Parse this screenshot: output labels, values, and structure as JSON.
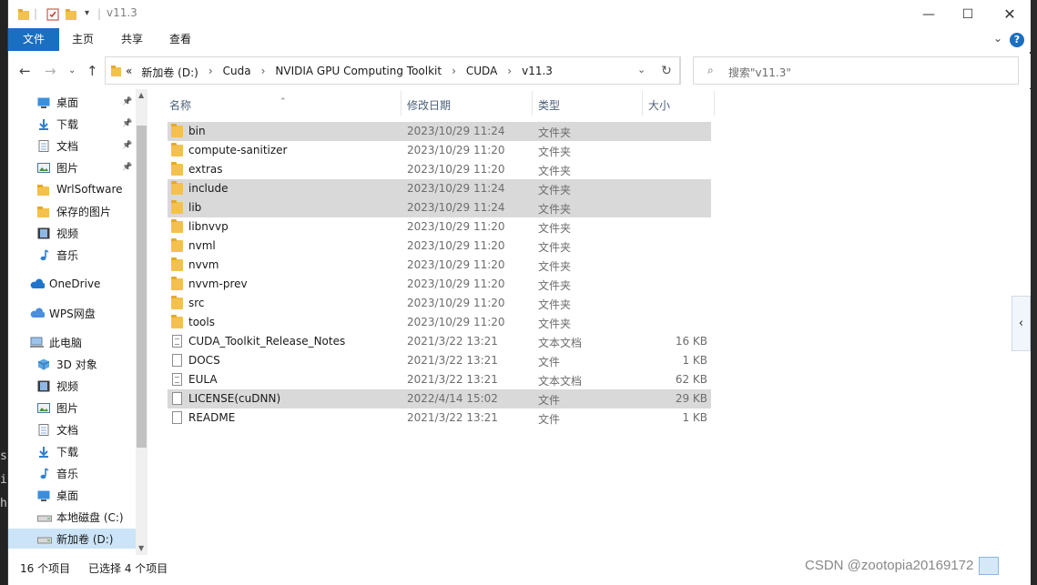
{
  "window": {
    "title": "v11.3"
  },
  "ribbon": {
    "tabs": [
      "文件",
      "主页",
      "共享",
      "查看"
    ]
  },
  "address": {
    "chevron": "«",
    "crumbs": [
      "新加卷 (D:)",
      "Cuda",
      "NVIDIA GPU Computing Toolkit",
      "CUDA",
      "v11.3"
    ],
    "separator": "›"
  },
  "search": {
    "placeholder": "搜索\"v11.3\""
  },
  "sidebar": {
    "items": [
      {
        "label": "桌面",
        "icon": "desktop-icon",
        "pinned": true
      },
      {
        "label": "下载",
        "icon": "download-icon",
        "pinned": true
      },
      {
        "label": "文档",
        "icon": "documents-icon",
        "pinned": true
      },
      {
        "label": "图片",
        "icon": "pictures-icon",
        "pinned": true
      },
      {
        "label": "WrlSoftware",
        "icon": "folder-icon",
        "pinned": false
      },
      {
        "label": "保存的图片",
        "icon": "folder-icon",
        "pinned": false
      },
      {
        "label": "视频",
        "icon": "videos-icon",
        "pinned": false
      },
      {
        "label": "音乐",
        "icon": "music-icon",
        "pinned": false
      },
      {
        "label": "OneDrive",
        "icon": "onedrive-icon",
        "pinned": false
      },
      {
        "label": "WPS网盘",
        "icon": "cloud-icon",
        "pinned": false
      },
      {
        "label": "此电脑",
        "icon": "computer-icon",
        "pinned": false
      },
      {
        "label": "3D 对象",
        "icon": "3d-objects-icon",
        "pinned": false
      },
      {
        "label": "视频",
        "icon": "videos-icon",
        "pinned": false
      },
      {
        "label": "图片",
        "icon": "pictures-icon",
        "pinned": false
      },
      {
        "label": "文档",
        "icon": "documents-icon",
        "pinned": false
      },
      {
        "label": "下载",
        "icon": "download-icon",
        "pinned": false
      },
      {
        "label": "音乐",
        "icon": "music-icon",
        "pinned": false
      },
      {
        "label": "桌面",
        "icon": "desktop-icon",
        "pinned": false
      },
      {
        "label": "本地磁盘 (C:)",
        "icon": "drive-icon",
        "pinned": false
      },
      {
        "label": "新加卷 (D:)",
        "icon": "drive-icon",
        "pinned": false,
        "selected": true
      }
    ]
  },
  "columns": {
    "name": "名称",
    "date": "修改日期",
    "type": "类型",
    "size": "大小"
  },
  "files": [
    {
      "name": "bin",
      "date": "2023/10/29 11:24",
      "type": "文件夹",
      "size": "",
      "kind": "folder",
      "selected": true
    },
    {
      "name": "compute-sanitizer",
      "date": "2023/10/29 11:20",
      "type": "文件夹",
      "size": "",
      "kind": "folder",
      "selected": false
    },
    {
      "name": "extras",
      "date": "2023/10/29 11:20",
      "type": "文件夹",
      "size": "",
      "kind": "folder",
      "selected": false
    },
    {
      "name": "include",
      "date": "2023/10/29 11:24",
      "type": "文件夹",
      "size": "",
      "kind": "folder",
      "selected": true
    },
    {
      "name": "lib",
      "date": "2023/10/29 11:24",
      "type": "文件夹",
      "size": "",
      "kind": "folder",
      "selected": true
    },
    {
      "name": "libnvvp",
      "date": "2023/10/29 11:20",
      "type": "文件夹",
      "size": "",
      "kind": "folder",
      "selected": false
    },
    {
      "name": "nvml",
      "date": "2023/10/29 11:20",
      "type": "文件夹",
      "size": "",
      "kind": "folder",
      "selected": false
    },
    {
      "name": "nvvm",
      "date": "2023/10/29 11:20",
      "type": "文件夹",
      "size": "",
      "kind": "folder",
      "selected": false
    },
    {
      "name": "nvvm-prev",
      "date": "2023/10/29 11:20",
      "type": "文件夹",
      "size": "",
      "kind": "folder",
      "selected": false
    },
    {
      "name": "src",
      "date": "2023/10/29 11:20",
      "type": "文件夹",
      "size": "",
      "kind": "folder",
      "selected": false
    },
    {
      "name": "tools",
      "date": "2023/10/29 11:20",
      "type": "文件夹",
      "size": "",
      "kind": "folder",
      "selected": false
    },
    {
      "name": "CUDA_Toolkit_Release_Notes",
      "date": "2021/3/22 13:21",
      "type": "文本文档",
      "size": "16 KB",
      "kind": "text",
      "selected": false
    },
    {
      "name": "DOCS",
      "date": "2021/3/22 13:21",
      "type": "文件",
      "size": "1 KB",
      "kind": "file",
      "selected": false
    },
    {
      "name": "EULA",
      "date": "2021/3/22 13:21",
      "type": "文本文档",
      "size": "62 KB",
      "kind": "text",
      "selected": false
    },
    {
      "name": "LICENSE(cuDNN)",
      "date": "2022/4/14 15:02",
      "type": "文件",
      "size": "29 KB",
      "kind": "file",
      "selected": true
    },
    {
      "name": "README",
      "date": "2021/3/22 13:21",
      "type": "文件",
      "size": "1 KB",
      "kind": "file",
      "selected": false
    }
  ],
  "status": {
    "count": "16 个项目",
    "selected": "已选择 4 个项目"
  },
  "watermark": "CSDN @zootopia20169172",
  "colors": {
    "accent": "#1a6fc1",
    "selection": "#d9d9d9",
    "nav_selection": "#cce4f7",
    "folder": "#f3c14c"
  }
}
